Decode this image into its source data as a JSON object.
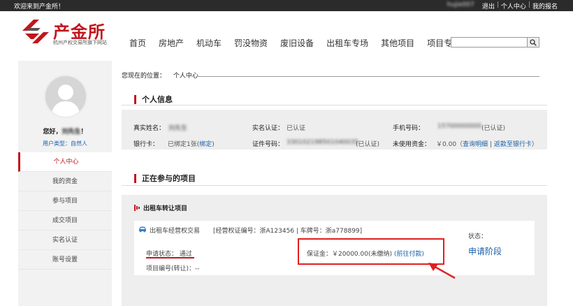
{
  "topbar": {
    "welcome": "欢迎来到产金所！",
    "user": "hujie007",
    "logout": "退出",
    "personal_center": "个人中心",
    "my_signup": "我的报名"
  },
  "logo": {
    "name": "产金所",
    "sub": "杭州产权交易所旗下网站"
  },
  "nav": [
    "首页",
    "房地产",
    "机动车",
    "罚没物资",
    "废旧设备",
    "出租车专场",
    "其他项目",
    "项目专场"
  ],
  "search": {
    "placeholder": ""
  },
  "sidebar": {
    "greet_prefix": "您好，",
    "greet_name": "刘先生",
    "greet_suffix": "！",
    "usertype_label": "用户类型：",
    "usertype_value": "自然人",
    "menu": [
      "个人中心",
      "我的资金",
      "参与项目",
      "成交项目",
      "实名认证",
      "账号设置"
    ]
  },
  "breadcrumb": {
    "label": "您现在的位置：",
    "current": "个人中心"
  },
  "personal_info": {
    "title": "个人信息",
    "real_name_label": "真实姓名：",
    "real_name": "刘先生",
    "verify_label": "实名认证：",
    "verify_value": "已认证",
    "phone_label": "手机号码：",
    "phone": "15700000000",
    "phone_status": "(已认证)",
    "bank_label": "银行卡：",
    "bank_value": "已绑定1张",
    "bank_bind": "绑定",
    "id_label": "证件号码：",
    "id_value": "330102198501040035",
    "id_status": "(已认证)",
    "funds_label": "未使用资金：",
    "funds_value": "￥0.00",
    "funds_detail": "查询明细",
    "funds_return": "返款至银行卡"
  },
  "projects": {
    "title": "正在参与的项目",
    "category": "出租车转让项目",
    "item_name": "出租车经营权交易",
    "license_info": "[经营权证编号：浙A123456 | 车牌号：浙a778899]",
    "status_label": "状态：",
    "stage": "申请阶段",
    "apply_status_label": "申请状态：",
    "apply_status": "通过",
    "deposit_label": "保证金：",
    "deposit_value": "￥20000.00(未缴纳)",
    "deposit_action": "(前往付款)",
    "code_label": "项目编号(转让)：",
    "code_value": "--"
  }
}
